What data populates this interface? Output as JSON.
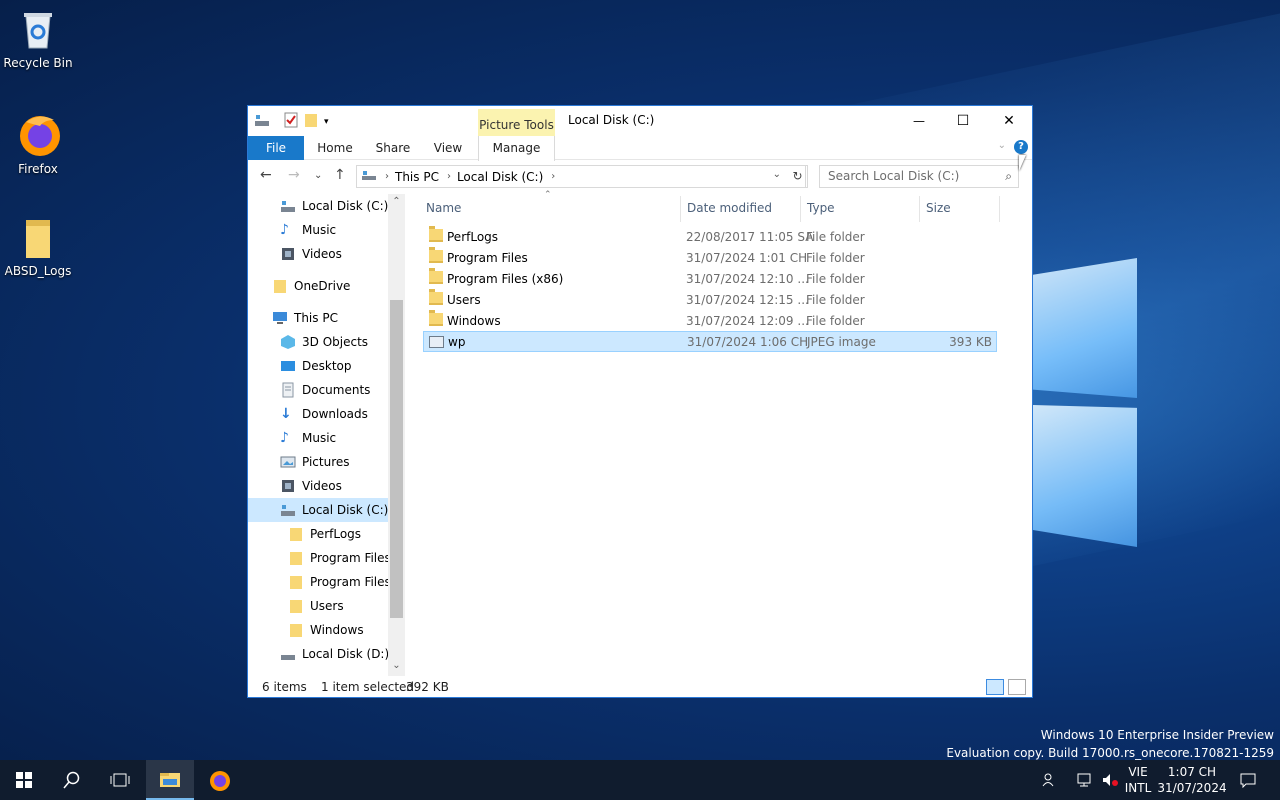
{
  "desktop": {
    "icons": [
      {
        "label": "Recycle Bin"
      },
      {
        "label": "Firefox"
      },
      {
        "label": "ABSD_Logs"
      }
    ],
    "watermark": {
      "line1": "Windows 10 Enterprise Insider Preview",
      "line2": "Evaluation copy. Build 17000.rs_onecore.170821-1259"
    }
  },
  "window": {
    "title": "Local Disk (C:)",
    "context_tab": "Picture Tools",
    "ribbon_tabs": [
      "File",
      "Home",
      "Share",
      "View",
      "Manage"
    ],
    "controls": {
      "minimize": "—",
      "maximize": "☐",
      "close": "✕"
    },
    "help": "?"
  },
  "address": {
    "segments": [
      "This PC",
      "Local Disk (C:)"
    ],
    "search_placeholder": "Search Local Disk (C:)"
  },
  "nav_pane": {
    "items": [
      {
        "label": "Local Disk (C:)",
        "icon": "drive-icon"
      },
      {
        "label": "Music",
        "icon": "music-icon"
      },
      {
        "label": "Videos",
        "icon": "videos-icon"
      },
      {
        "label": "OneDrive",
        "icon": "folder-icon"
      },
      {
        "label": "This PC",
        "icon": "computer-icon"
      },
      {
        "label": "3D Objects",
        "icon": "3d-objects-icon"
      },
      {
        "label": "Desktop",
        "icon": "desktop-icon"
      },
      {
        "label": "Documents",
        "icon": "documents-icon"
      },
      {
        "label": "Downloads",
        "icon": "downloads-icon"
      },
      {
        "label": "Music",
        "icon": "music-icon"
      },
      {
        "label": "Pictures",
        "icon": "pictures-icon"
      },
      {
        "label": "Videos",
        "icon": "videos-icon"
      },
      {
        "label": "Local Disk (C:)",
        "icon": "drive-icon",
        "selected": true
      },
      {
        "label": "PerfLogs",
        "icon": "folder-icon"
      },
      {
        "label": "Program Files",
        "icon": "folder-icon"
      },
      {
        "label": "Program Files (",
        "icon": "folder-icon"
      },
      {
        "label": "Users",
        "icon": "folder-icon"
      },
      {
        "label": "Windows",
        "icon": "folder-icon"
      },
      {
        "label": "Local Disk (D:)",
        "icon": "drive-icon"
      }
    ]
  },
  "file_list": {
    "columns": [
      "Name",
      "Date modified",
      "Type",
      "Size"
    ],
    "rows": [
      {
        "name": "PerfLogs",
        "date": "22/08/2017 11:05 SA",
        "type": "File folder",
        "size": "",
        "kind": "folder"
      },
      {
        "name": "Program Files",
        "date": "31/07/2024 1:01 CH",
        "type": "File folder",
        "size": "",
        "kind": "folder"
      },
      {
        "name": "Program Files (x86)",
        "date": "31/07/2024 12:10 ...",
        "type": "File folder",
        "size": "",
        "kind": "folder"
      },
      {
        "name": "Users",
        "date": "31/07/2024 12:15 ...",
        "type": "File folder",
        "size": "",
        "kind": "folder"
      },
      {
        "name": "Windows",
        "date": "31/07/2024 12:09 ...",
        "type": "File folder",
        "size": "",
        "kind": "folder"
      },
      {
        "name": "wp",
        "date": "31/07/2024 1:06 CH",
        "type": "JPEG image",
        "size": "393 KB",
        "kind": "image",
        "selected": true
      }
    ]
  },
  "status_bar": {
    "count": "6 items",
    "selection": "1 item selected",
    "selection_size": "392 KB"
  },
  "taskbar": {
    "lang_top": "VIE",
    "lang_bottom": "INTL",
    "time": "1:07 CH",
    "date": "31/07/2024"
  }
}
